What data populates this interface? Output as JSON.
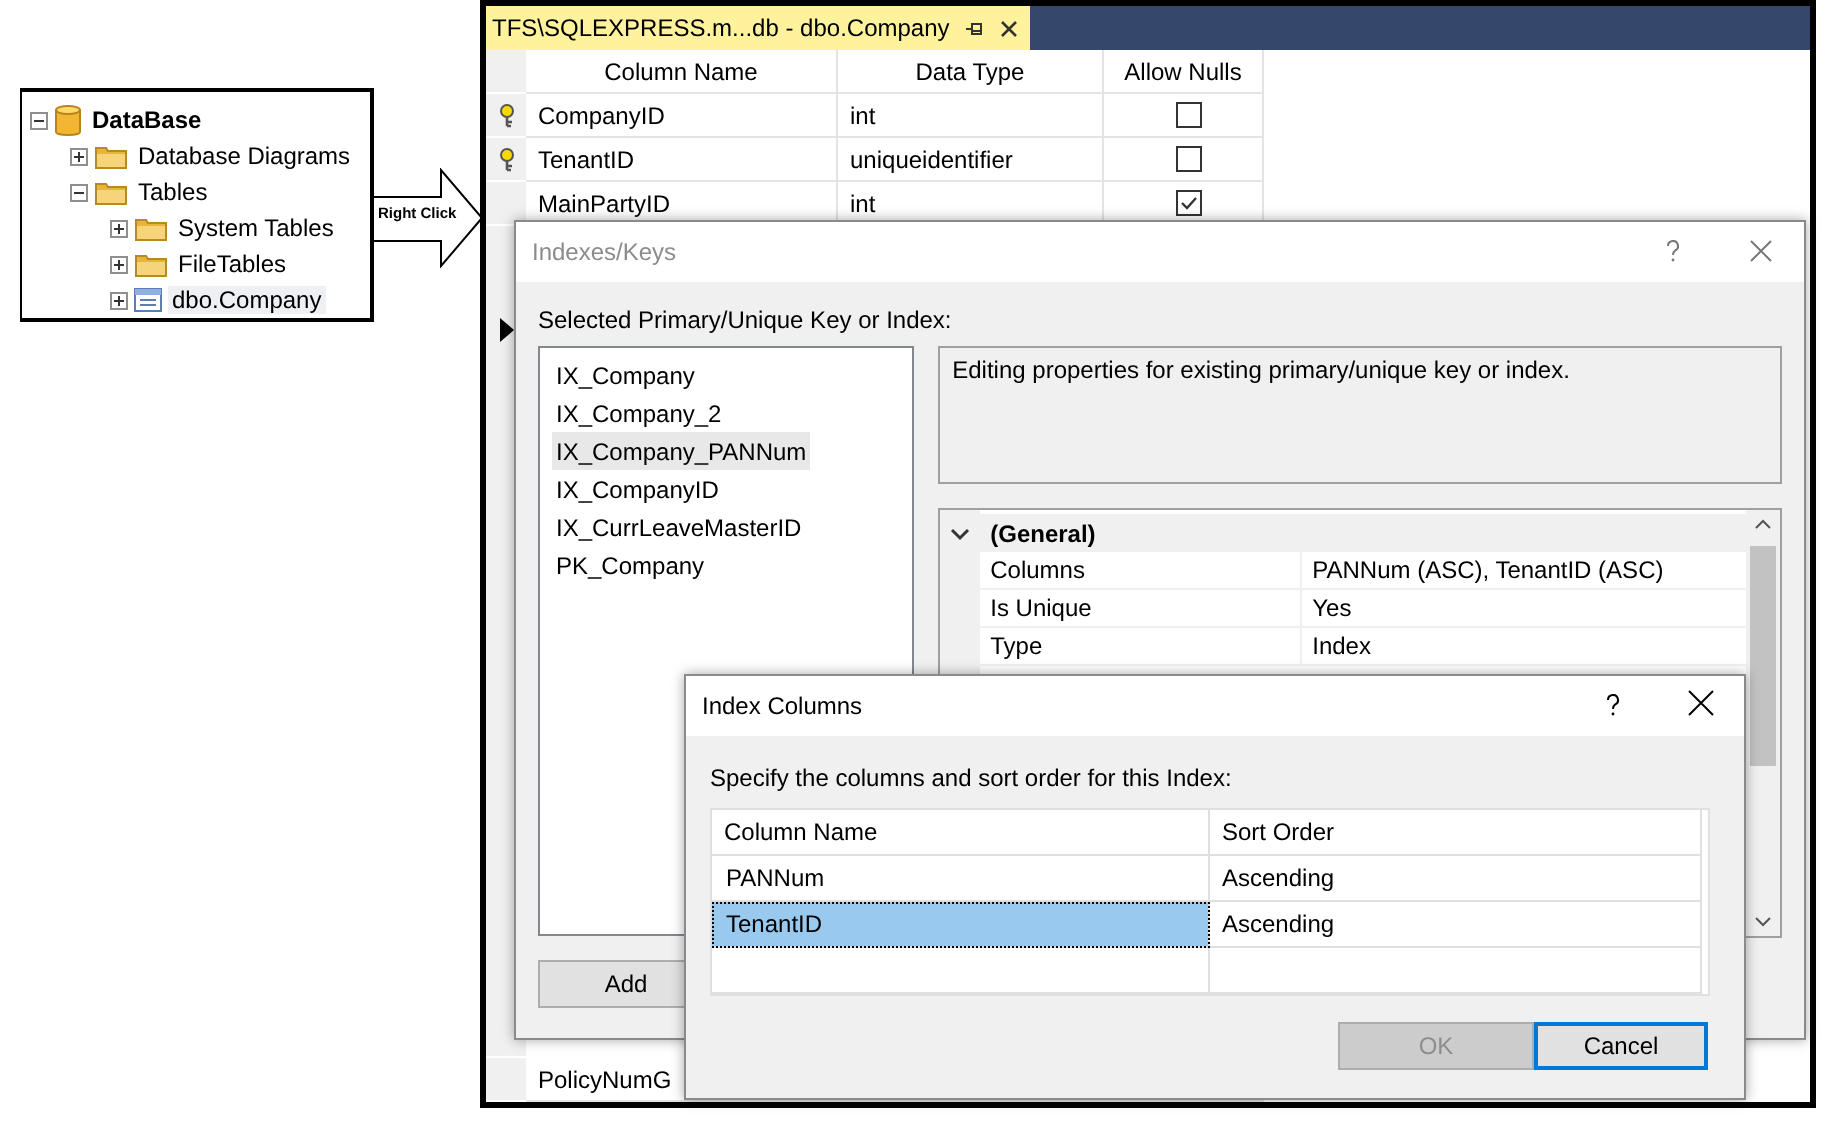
{
  "tree": {
    "label": "DataBase",
    "kind": "database",
    "expanded": true,
    "children": [
      {
        "label": "Database Diagrams",
        "kind": "folder",
        "expanded": false
      },
      {
        "label": "Tables",
        "kind": "folder",
        "expanded": true,
        "children": [
          {
            "label": "System Tables",
            "kind": "folder",
            "expanded": false
          },
          {
            "label": "FileTables",
            "kind": "folder",
            "expanded": false
          },
          {
            "label": "dbo.Company",
            "kind": "table",
            "expanded": false,
            "selected": true
          }
        ]
      }
    ]
  },
  "arrow_label": "Right Click",
  "editor": {
    "tab": {
      "title": "TFS\\SQLEXPRESS.m...db - dbo.Company"
    },
    "columns": [
      "Column Name",
      "Data Type",
      "Allow Nulls"
    ],
    "rows": [
      {
        "name": "CompanyID",
        "type": "int",
        "primary_key": true,
        "allow_nulls": false
      },
      {
        "name": "TenantID",
        "type": "uniqueidentifier",
        "primary_key": true,
        "allow_nulls": false
      },
      {
        "name": "MainPartyID",
        "type": "int",
        "primary_key": false,
        "allow_nulls": true
      }
    ],
    "current_row_marker": true,
    "bottom_row": {
      "name": "PolicyNumG"
    }
  },
  "indexes_dialog": {
    "title": "Indexes/Keys",
    "active": false,
    "label": "Selected Primary/Unique Key or Index:",
    "indexes": [
      {
        "name": "IX_Company",
        "selected": false
      },
      {
        "name": "IX_Company_2",
        "selected": false
      },
      {
        "name": "IX_Company_PANNum",
        "selected": true
      },
      {
        "name": "IX_CompanyID",
        "selected": false
      },
      {
        "name": "IX_CurrLeaveMasterID",
        "selected": false
      },
      {
        "name": "PK_Company",
        "selected": false
      }
    ],
    "description": "Editing properties for existing primary/unique key or index.",
    "properties": [
      {
        "kind": "category",
        "label": "(General)",
        "expanded": true
      },
      {
        "kind": "property",
        "name": "Columns",
        "value": "PANNum (ASC), TenantID (ASC)"
      },
      {
        "kind": "property",
        "name": "Is Unique",
        "value": "Yes"
      },
      {
        "kind": "property",
        "name": "Type",
        "value": "Index"
      }
    ],
    "buttons": [
      "Add"
    ]
  },
  "columns_dialog": {
    "title": "Index Columns",
    "active": true,
    "label": "Specify the columns and sort order for this Index:",
    "headers": [
      "Column Name",
      "Sort Order"
    ],
    "rows": [
      {
        "column": "PANNum",
        "sort": "Ascending",
        "selected": false
      },
      {
        "column": "TenantID",
        "sort": "Ascending",
        "selected": true
      }
    ],
    "buttons": [
      {
        "label": "OK",
        "disabled": true,
        "default": false
      },
      {
        "label": "Cancel",
        "disabled": false,
        "default": true
      }
    ]
  }
}
